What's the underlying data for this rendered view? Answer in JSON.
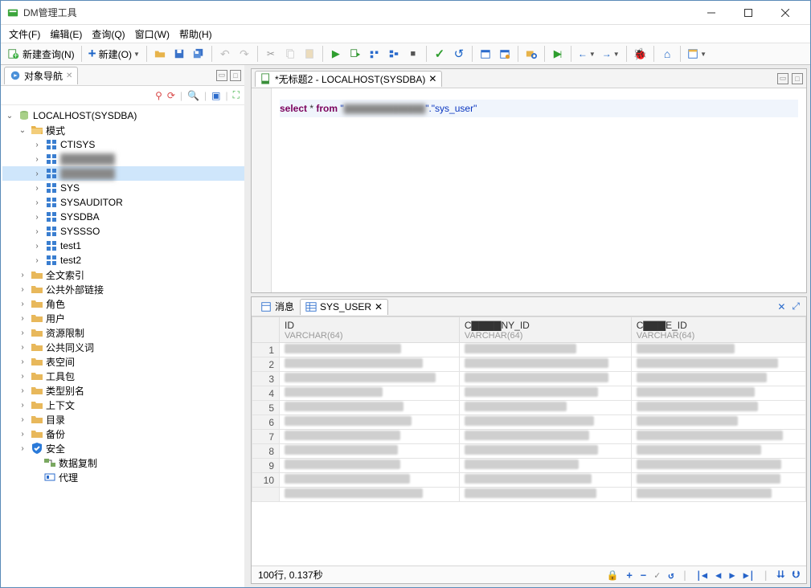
{
  "window": {
    "title": "DM管理工具"
  },
  "menu": {
    "file": "文件(F)",
    "edit": "编辑(E)",
    "query": "查询(Q)",
    "window": "窗口(W)",
    "help": "帮助(H)"
  },
  "toolbar": {
    "new_query": "新建查询(N)",
    "new": "新建(O)"
  },
  "nav": {
    "tab": "对象导航",
    "root": "LOCALHOST(SYSDBA)",
    "schema_label": "模式",
    "schemas": [
      "CTISYS",
      "",
      "",
      "SYS",
      "SYSAUDITOR",
      "SYSDBA",
      "SYSSSO",
      "test1",
      "test2"
    ],
    "folders": [
      "全文索引",
      "公共外部链接",
      "角色",
      "用户",
      "资源限制",
      "公共同义词",
      "表空间",
      "工具包",
      "类型别名",
      "上下文",
      "目录",
      "备份"
    ],
    "safety": "安全",
    "replication": "数据复制",
    "agent": "代理"
  },
  "editor": {
    "tab": "*无标题2 - LOCALHOST(SYSDBA)",
    "sql": {
      "kw1": "select",
      "star": "*",
      "kw2": "from",
      "q1": "\"",
      "censored": "▇▇▇▇▇▇▇▇▇▇▇",
      "mid": "\".\"",
      "table": "sys_user",
      "q2": "\""
    }
  },
  "results": {
    "msg_tab": "消息",
    "data_tab": "SYS_USER",
    "columns": [
      {
        "name": "ID",
        "type": "VARCHAR(64)"
      },
      {
        "name": "C▇▇▇▇NY_ID",
        "type": "VARCHAR(64)"
      },
      {
        "name": "C▇▇▇E_ID",
        "type": "VARCHAR(64)"
      }
    ],
    "rows": 11,
    "status": "100行, 0.137秒"
  }
}
